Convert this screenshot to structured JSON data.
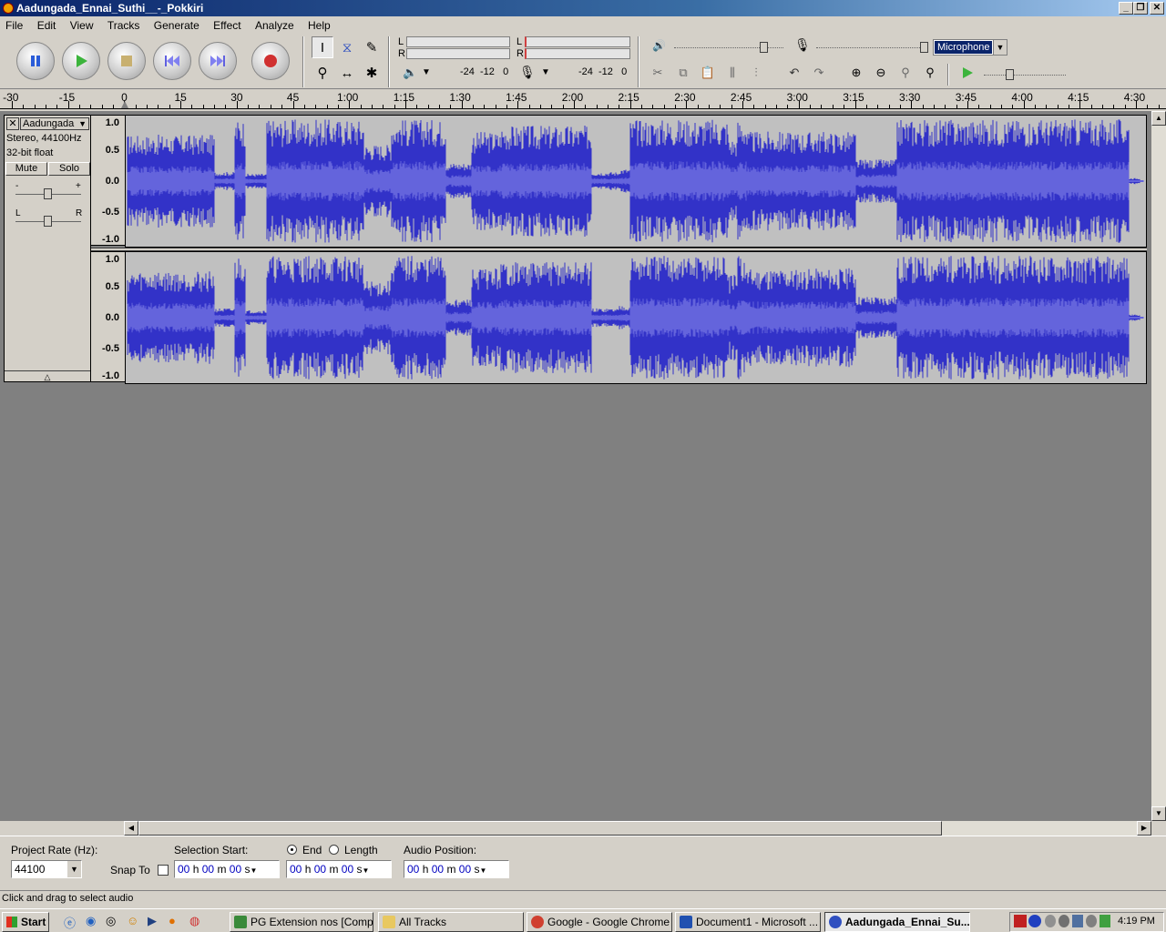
{
  "window": {
    "title": "Aadungada_Ennai_Suthi__-_Pokkiri"
  },
  "menu": [
    "File",
    "Edit",
    "View",
    "Tracks",
    "Generate",
    "Effect",
    "Analyze",
    "Help"
  ],
  "meters": {
    "left": "L",
    "right": "R",
    "scale": "-24  -12   0"
  },
  "mixer": {
    "input_source": "Microphone"
  },
  "ruler": {
    "labels": [
      "-30",
      "-15",
      "0",
      "15",
      "30",
      "45",
      "1:00",
      "1:15",
      "1:30",
      "1:45",
      "2:00",
      "2:15",
      "2:30",
      "2:45",
      "3:00",
      "3:15",
      "3:30",
      "3:45",
      "4:00",
      "4:15",
      "4:30"
    ]
  },
  "track": {
    "name": "Aadungada",
    "info1": "Stereo, 44100Hz",
    "info2": "32-bit float",
    "mute": "Mute",
    "solo": "Solo",
    "gain_minus": "-",
    "gain_plus": "+",
    "pan_left": "L",
    "pan_right": "R",
    "scale": [
      "1.0",
      "0.5",
      "0.0",
      "-0.5",
      "-1.0"
    ]
  },
  "bottom": {
    "project_rate_label": "Project Rate (Hz):",
    "project_rate": "44100",
    "snap_to": "Snap To",
    "selection_start": "Selection Start:",
    "end": "End",
    "length": "Length",
    "audio_position": "Audio Position:",
    "time_h": "00",
    "time_m": "00",
    "unit_h": "h",
    "unit_m": "m",
    "unit_s": "s"
  },
  "status": "Click and drag to select audio",
  "taskbar": {
    "start": "Start",
    "tasks": [
      "PG Extension nos  [Comp...",
      "All Tracks",
      "Google - Google Chrome",
      "Document1 - Microsoft ...",
      "Aadungada_Ennai_Su..."
    ],
    "clock": "4:19 PM"
  }
}
